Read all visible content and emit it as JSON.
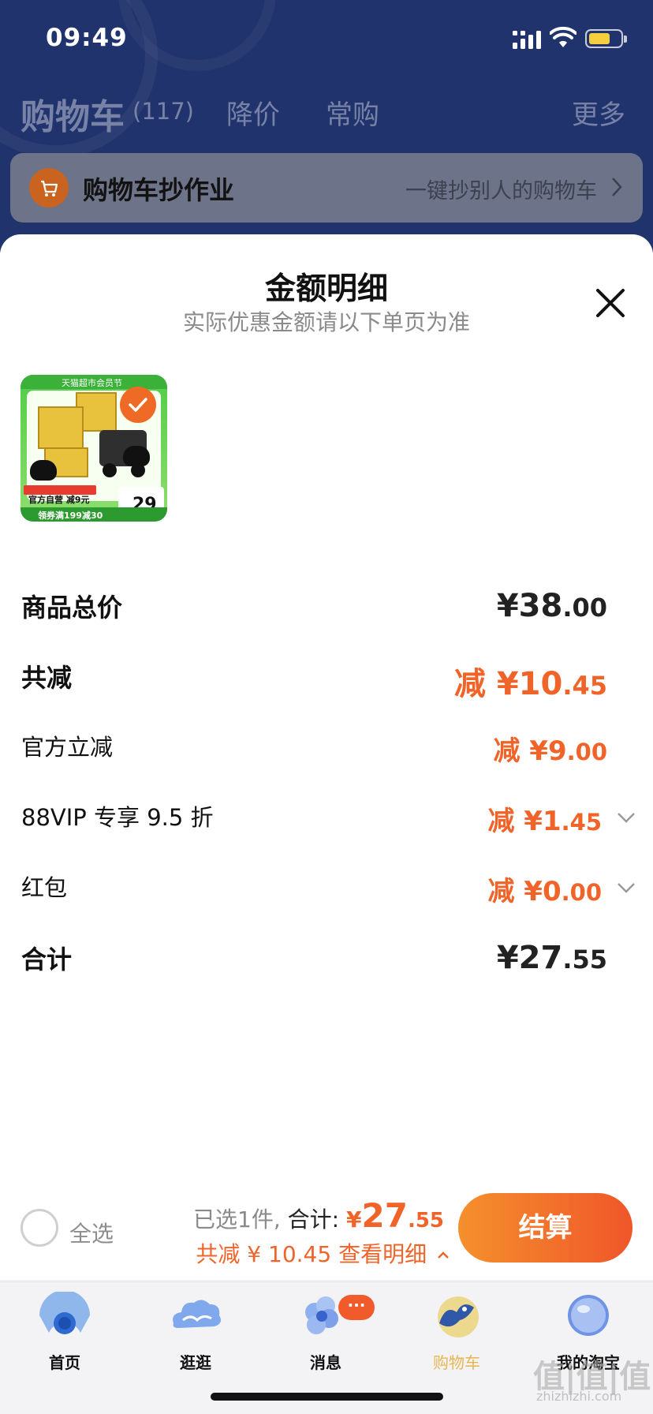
{
  "status_bar": {
    "time": "09:49"
  },
  "header": {
    "cart_title": "购物车",
    "cart_count": "(117)",
    "tab_price_drop": "降价",
    "tab_frequent": "常购",
    "tab_more": "更多"
  },
  "banner": {
    "title": "购物车抄作业",
    "subtitle": "一键抄别人的购物车"
  },
  "sheet": {
    "title": "金额明细",
    "subtitle": "实际优惠金额请以下单页为准"
  },
  "product": {
    "top_text": "天猫超市会员节",
    "promo_text": "官方自营 减9元",
    "coupon_text": "领券满199减30",
    "price_tag": "29"
  },
  "rows": [
    {
      "label": "商品总价",
      "value_pre": "¥38",
      "value_dec": ".00"
    },
    {
      "label": "共减",
      "value_pre": "减 ¥10",
      "value_dec": ".45"
    },
    {
      "label": "官方立减",
      "value_pre": "减 ¥9",
      "value_dec": ".00"
    },
    {
      "label": "88VIP 专享 9.5 折",
      "value_pre": "减 ¥1",
      "value_dec": ".45"
    },
    {
      "label": "红包",
      "value_pre": "减 ¥0",
      "value_dec": ".00"
    },
    {
      "label": "合计",
      "value_pre": "¥27",
      "value_dec": ".55"
    }
  ],
  "checkout": {
    "select_all": "全选",
    "selected_text": "已选1件,",
    "total_label": "合计:",
    "total_currency": "¥",
    "total_int": "27",
    "total_dec": ".55",
    "discount_text": "共减 ¥ 10.45",
    "details_link": "查看明细",
    "button_label": "结算"
  },
  "nav": {
    "home": "首页",
    "browse": "逛逛",
    "messages": "消息",
    "messages_badge": "···",
    "cart": "购物车",
    "me": "我的淘宝"
  },
  "watermark": {
    "main": "值|值|值",
    "sub": "zhizhizhi.com"
  },
  "colors": {
    "accent": "#f0642a",
    "header_bg": "#21336c",
    "active_tab": "#e6b650"
  }
}
